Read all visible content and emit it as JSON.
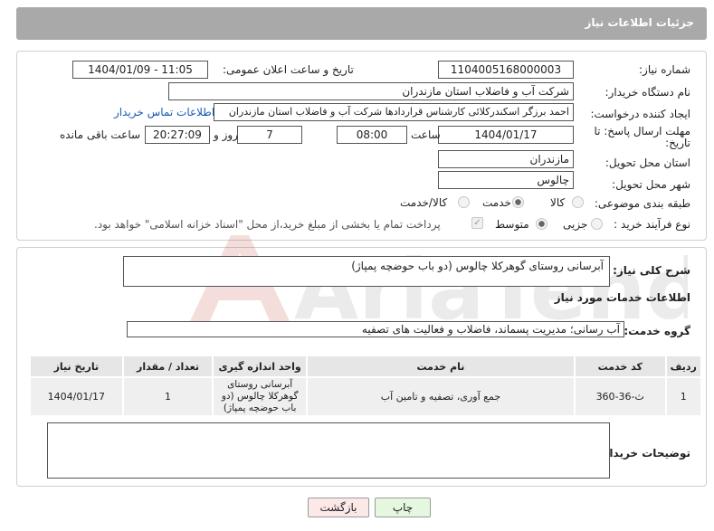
{
  "header": {
    "title": "جزئیات اطلاعات نیاز"
  },
  "form": {
    "need_number_label": "شماره نیاز:",
    "need_number": "1104005168000003",
    "announce_label": "تاریخ و ساعت اعلان عمومی:",
    "announce_value": "1404/01/09 - 11:05",
    "buyer_label": "نام دستگاه خریدار:",
    "buyer_value": "شرکت آب و فاضلاب استان مازندران",
    "creator_label": "ایجاد کننده درخواست:",
    "creator_value": "احمد برزگر اسکندرکلائی کارشناس قراردادها شرکت آب و فاضلاب استان مازندران",
    "contact_link": "اطلاعات تماس خریدار",
    "deadline_label_1": "مهلت ارسال پاسخ: تا",
    "deadline_label_2": "تاریخ:",
    "deadline_date": "1404/01/17",
    "time_label": "ساعت",
    "deadline_time": "08:00",
    "days_value": "7",
    "days_label": "روز و",
    "remaining_value": "20:27:09",
    "remaining_label": "ساعت باقی مانده",
    "province_label": "استان محل تحویل:",
    "province_value": "مازندران",
    "city_label": "شهر محل تحویل:",
    "city_value": "چالوس",
    "category_label": "طبقه بندی موضوعی:",
    "category_options": [
      "کالا",
      "خدمت",
      "کالا/خدمت"
    ],
    "category_selected": "خدمت",
    "process_label": "نوع فرآیند خرید :",
    "process_options": [
      "جزیی",
      "متوسط"
    ],
    "process_selected": "متوسط",
    "payment_note": "پرداخت تمام یا بخشی از مبلغ خرید،از محل \"اسناد خزانه اسلامی\" خواهد بود."
  },
  "summary": {
    "label": "شرح کلی نیاز:",
    "value": "آبرسانی روستای گوهرکلا چالوس (دو باب حوضچه پمپاژ)"
  },
  "services": {
    "section_title": "اطلاعات خدمات مورد نیاز",
    "group_label": "گروه خدمت:",
    "group_value": "آب رسانی؛ مدیریت پسماند، فاضلاب و فعالیت های تصفیه",
    "columns": [
      "ردیف",
      "کد خدمت",
      "نام خدمت",
      "واحد اندازه گیری",
      "تعداد / مقدار",
      "تاریخ نیاز"
    ],
    "rows": [
      {
        "row": "1",
        "code": "ث-36-360",
        "name": "جمع آوری، تصفیه و تامین آب",
        "unit": "آبرسانی روستای گوهرکلا چالوس (دو باب حوضچه پمپاژ)",
        "qty": "1",
        "date": "1404/01/17"
      }
    ]
  },
  "buyer_notes": {
    "label": "توضیحات خریدار:",
    "value": ""
  },
  "buttons": {
    "print": "چاپ",
    "back": "بازگشت"
  },
  "watermark": {
    "text": "AriaTender.net"
  },
  "colors": {
    "header_bg": "#a9a9a9",
    "link": "#1a5bb5",
    "print_bg": "#e6f7df",
    "back_bg": "#fde8e8"
  }
}
